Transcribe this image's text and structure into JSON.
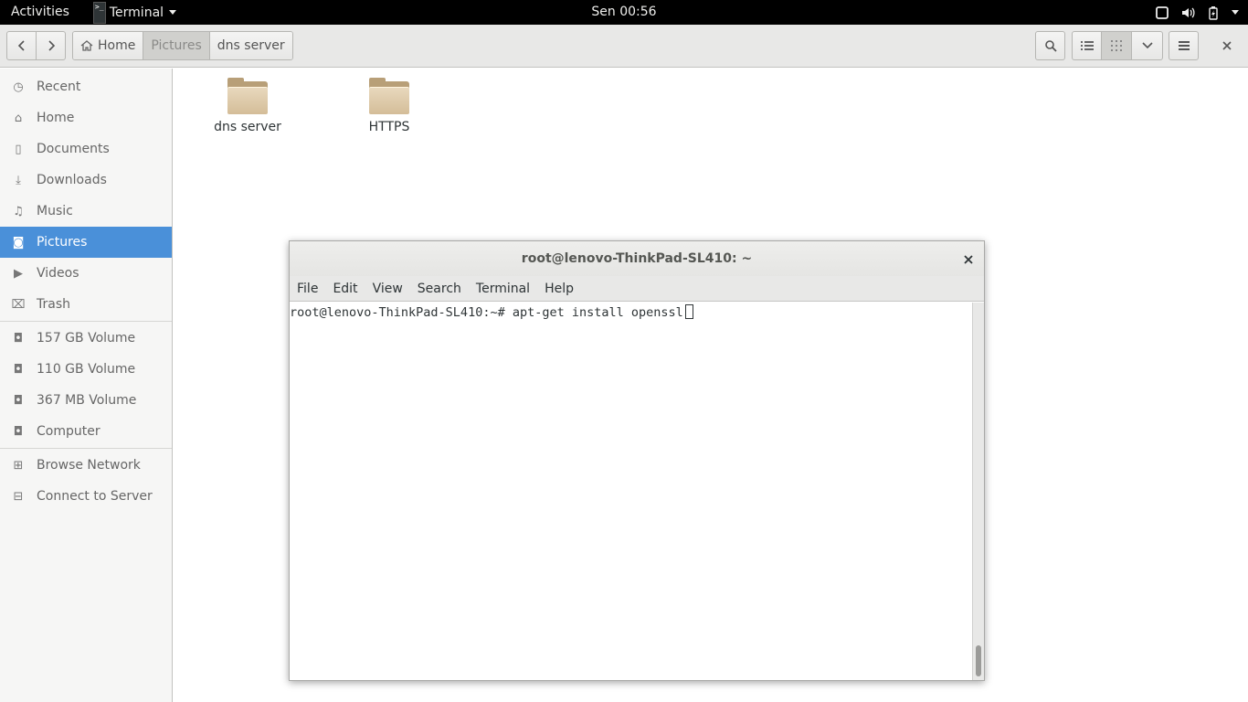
{
  "topbar": {
    "activities": "Activities",
    "app_name": "Terminal",
    "clock": "Sen 00:56"
  },
  "header": {
    "breadcrumbs": [
      {
        "label": "Home"
      },
      {
        "label": "Pictures"
      },
      {
        "label": "dns server"
      }
    ]
  },
  "sidebar": {
    "places": [
      {
        "label": "Recent",
        "icon": "clock-icon"
      },
      {
        "label": "Home",
        "icon": "home-icon"
      },
      {
        "label": "Documents",
        "icon": "document-icon"
      },
      {
        "label": "Downloads",
        "icon": "download-icon"
      },
      {
        "label": "Music",
        "icon": "music-icon"
      },
      {
        "label": "Pictures",
        "icon": "camera-icon"
      },
      {
        "label": "Videos",
        "icon": "video-icon"
      },
      {
        "label": "Trash",
        "icon": "trash-icon"
      }
    ],
    "devices": [
      {
        "label": "157 GB Volume",
        "icon": "drive-icon"
      },
      {
        "label": "110 GB Volume",
        "icon": "drive-icon"
      },
      {
        "label": "367 MB Volume",
        "icon": "drive-icon"
      },
      {
        "label": "Computer",
        "icon": "computer-icon"
      }
    ],
    "network": [
      {
        "label": "Browse Network",
        "icon": "network-icon"
      },
      {
        "label": "Connect to Server",
        "icon": "server-icon"
      }
    ]
  },
  "content": {
    "folders": [
      {
        "label": "dns server"
      },
      {
        "label": "HTTPS"
      }
    ]
  },
  "terminal": {
    "title": "root@lenovo-ThinkPad-SL410: ~",
    "menu": [
      "File",
      "Edit",
      "View",
      "Search",
      "Terminal",
      "Help"
    ],
    "line": "root@lenovo-ThinkPad-SL410:~# apt-get install openssl"
  }
}
